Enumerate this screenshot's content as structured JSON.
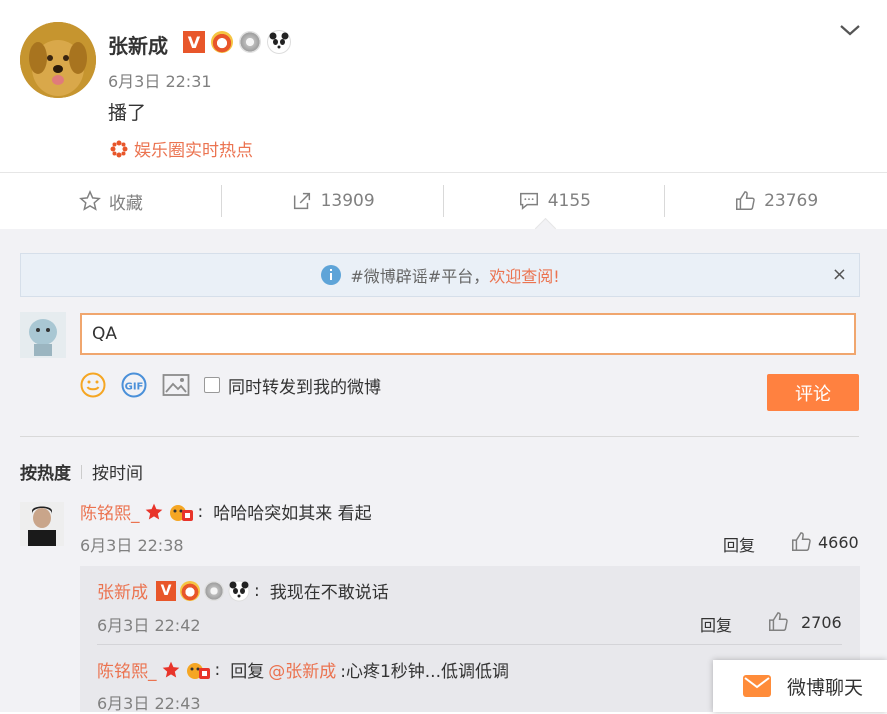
{
  "post": {
    "username": "张新成",
    "vip_badge": "V",
    "time": "6月3日 22:31",
    "content": "播了",
    "topic": "娱乐圈实时热点"
  },
  "actions": {
    "favorite": "收藏",
    "repost_count": "13909",
    "comment_count": "4155",
    "like_count": "23769"
  },
  "notice": {
    "prefix": "#微博辟谣#平台，",
    "highlight": "欢迎查阅!",
    "close": "×"
  },
  "composer": {
    "value": "QA",
    "sync_label": "同时转发到我的微博",
    "submit": "评论"
  },
  "sort": {
    "hot": "按热度",
    "time": "按时间"
  },
  "comments": [
    {
      "name": "陈铭熙_",
      "sep": ":",
      "text": "哈哈哈突如其来 看起",
      "time": "6月3日 22:38",
      "reply": "回复",
      "likes": "4660"
    }
  ],
  "replies": [
    {
      "name": "张新成",
      "vip": "V",
      "sep": ":",
      "text": "我现在不敢说话",
      "time": "6月3日 22:42",
      "reply": "回复",
      "likes": "2706"
    },
    {
      "name": "陈铭熙_",
      "sep": ":",
      "text_prefix": "回复",
      "mention": "@张新成",
      "text": ":心疼1秒钟...低调低调",
      "time": "6月3日 22:43"
    }
  ],
  "chat": {
    "label": "微博聊天"
  },
  "colors": {
    "accent": "#eb7350",
    "button": "#ff8140",
    "panel": "#f2f2f5"
  }
}
